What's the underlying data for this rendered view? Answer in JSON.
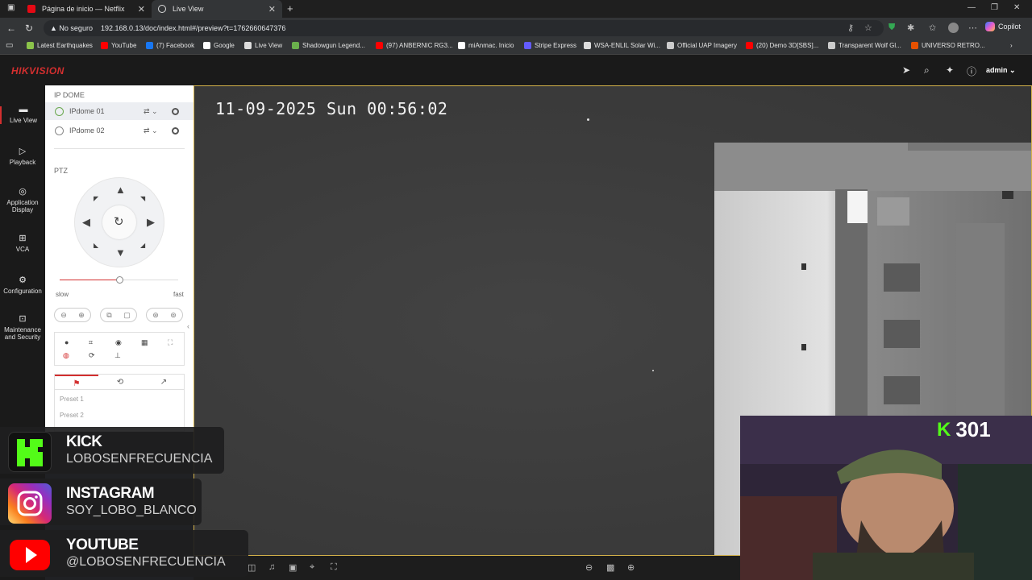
{
  "browser": {
    "tabs": [
      {
        "label": "Página de inicio — Netflix",
        "color": "#e50914"
      },
      {
        "label": "Live View",
        "color": "#ffffff"
      }
    ],
    "address": {
      "security": "No seguro",
      "url": "192.168.0.13/doc/index.html#/preview?t=1762660647376"
    },
    "copilot_label": "Copilot",
    "bookmarks": [
      {
        "label": "Latest Earthquakes",
        "color": "#8bc34a"
      },
      {
        "label": "YouTube",
        "color": "#ff0000"
      },
      {
        "label": "(7) Facebook",
        "color": "#1877f2"
      },
      {
        "label": "Google",
        "color": "#ffffff"
      },
      {
        "label": "Live View",
        "color": "#dddddd"
      },
      {
        "label": "Shadowgun Legend...",
        "color": "#6ab04c"
      },
      {
        "label": "(97) ANBERNIC RG3...",
        "color": "#ff0000"
      },
      {
        "label": "miAnmac. Inicio",
        "color": "#ffffff"
      },
      {
        "label": "Stripe Express",
        "color": "#635bff"
      },
      {
        "label": "WSA-ENLIL Solar Wi...",
        "color": "#dddddd"
      },
      {
        "label": "Official UAP Imagery",
        "color": "#cccccc"
      },
      {
        "label": "(20) Demo 3D[SBS]...",
        "color": "#ff0000"
      },
      {
        "label": "Transparent Wolf Gl...",
        "color": "#cccccc"
      },
      {
        "label": "UNIVERSO RETRO...",
        "color": "#e65100"
      }
    ]
  },
  "app": {
    "logo": "HIKVISION",
    "user": "admin",
    "nav": [
      {
        "label": "Live View",
        "icon": "monitor-icon"
      },
      {
        "label": "Playback",
        "icon": "playback-icon"
      },
      {
        "label": "Application Display",
        "icon": "app-display-icon"
      },
      {
        "label": "VCA",
        "icon": "vca-icon"
      },
      {
        "label": "Configuration",
        "icon": "gear-icon"
      },
      {
        "label": "Maintenance and Security",
        "icon": "maintenance-icon"
      }
    ],
    "device_section": "IP DOME",
    "cameras": [
      {
        "name": "IPdome 01"
      },
      {
        "name": "IPdome 02"
      }
    ],
    "ptz": {
      "title": "PTZ",
      "speed_slow": "slow",
      "speed_fast": "fast",
      "speed_level": 0.5,
      "presets": [
        "Preset 1",
        "Preset 2"
      ]
    },
    "video": {
      "timestamp": "11-09-2025 Sun 00:56:02"
    }
  },
  "overlay": {
    "socials": [
      {
        "title": "KICK",
        "handle": "LOBOSENFRECUENCIA",
        "color": "#53fc18"
      },
      {
        "title": "INSTAGRAM",
        "handle": "SOY_LOBO_BLANCO",
        "color": "#e1306c"
      },
      {
        "title": "YOUTUBE",
        "handle": "@LOBOSENFRECUENCIA",
        "color": "#ff0000"
      }
    ],
    "kick_count": "301",
    "kick_k": "K"
  }
}
